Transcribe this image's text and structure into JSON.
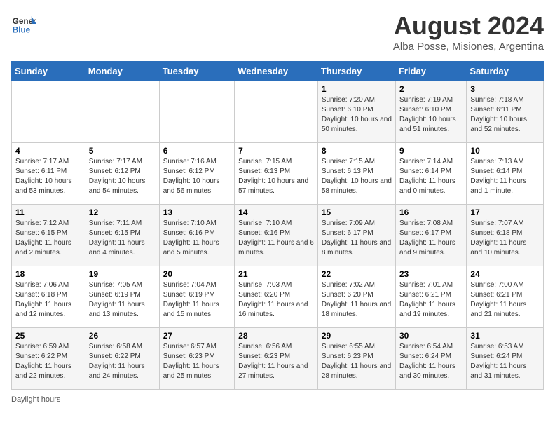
{
  "header": {
    "logo_general": "General",
    "logo_blue": "Blue",
    "month": "August 2024",
    "location": "Alba Posse, Misiones, Argentina"
  },
  "days_of_week": [
    "Sunday",
    "Monday",
    "Tuesday",
    "Wednesday",
    "Thursday",
    "Friday",
    "Saturday"
  ],
  "weeks": [
    [
      {
        "day": "",
        "info": ""
      },
      {
        "day": "",
        "info": ""
      },
      {
        "day": "",
        "info": ""
      },
      {
        "day": "",
        "info": ""
      },
      {
        "day": "1",
        "info": "Sunrise: 7:20 AM\nSunset: 6:10 PM\nDaylight: 10 hours and 50 minutes."
      },
      {
        "day": "2",
        "info": "Sunrise: 7:19 AM\nSunset: 6:10 PM\nDaylight: 10 hours and 51 minutes."
      },
      {
        "day": "3",
        "info": "Sunrise: 7:18 AM\nSunset: 6:11 PM\nDaylight: 10 hours and 52 minutes."
      }
    ],
    [
      {
        "day": "4",
        "info": "Sunrise: 7:17 AM\nSunset: 6:11 PM\nDaylight: 10 hours and 53 minutes."
      },
      {
        "day": "5",
        "info": "Sunrise: 7:17 AM\nSunset: 6:12 PM\nDaylight: 10 hours and 54 minutes."
      },
      {
        "day": "6",
        "info": "Sunrise: 7:16 AM\nSunset: 6:12 PM\nDaylight: 10 hours and 56 minutes."
      },
      {
        "day": "7",
        "info": "Sunrise: 7:15 AM\nSunset: 6:13 PM\nDaylight: 10 hours and 57 minutes."
      },
      {
        "day": "8",
        "info": "Sunrise: 7:15 AM\nSunset: 6:13 PM\nDaylight: 10 hours and 58 minutes."
      },
      {
        "day": "9",
        "info": "Sunrise: 7:14 AM\nSunset: 6:14 PM\nDaylight: 11 hours and 0 minutes."
      },
      {
        "day": "10",
        "info": "Sunrise: 7:13 AM\nSunset: 6:14 PM\nDaylight: 11 hours and 1 minute."
      }
    ],
    [
      {
        "day": "11",
        "info": "Sunrise: 7:12 AM\nSunset: 6:15 PM\nDaylight: 11 hours and 2 minutes."
      },
      {
        "day": "12",
        "info": "Sunrise: 7:11 AM\nSunset: 6:15 PM\nDaylight: 11 hours and 4 minutes."
      },
      {
        "day": "13",
        "info": "Sunrise: 7:10 AM\nSunset: 6:16 PM\nDaylight: 11 hours and 5 minutes."
      },
      {
        "day": "14",
        "info": "Sunrise: 7:10 AM\nSunset: 6:16 PM\nDaylight: 11 hours and 6 minutes."
      },
      {
        "day": "15",
        "info": "Sunrise: 7:09 AM\nSunset: 6:17 PM\nDaylight: 11 hours and 8 minutes."
      },
      {
        "day": "16",
        "info": "Sunrise: 7:08 AM\nSunset: 6:17 PM\nDaylight: 11 hours and 9 minutes."
      },
      {
        "day": "17",
        "info": "Sunrise: 7:07 AM\nSunset: 6:18 PM\nDaylight: 11 hours and 10 minutes."
      }
    ],
    [
      {
        "day": "18",
        "info": "Sunrise: 7:06 AM\nSunset: 6:18 PM\nDaylight: 11 hours and 12 minutes."
      },
      {
        "day": "19",
        "info": "Sunrise: 7:05 AM\nSunset: 6:19 PM\nDaylight: 11 hours and 13 minutes."
      },
      {
        "day": "20",
        "info": "Sunrise: 7:04 AM\nSunset: 6:19 PM\nDaylight: 11 hours and 15 minutes."
      },
      {
        "day": "21",
        "info": "Sunrise: 7:03 AM\nSunset: 6:20 PM\nDaylight: 11 hours and 16 minutes."
      },
      {
        "day": "22",
        "info": "Sunrise: 7:02 AM\nSunset: 6:20 PM\nDaylight: 11 hours and 18 minutes."
      },
      {
        "day": "23",
        "info": "Sunrise: 7:01 AM\nSunset: 6:21 PM\nDaylight: 11 hours and 19 minutes."
      },
      {
        "day": "24",
        "info": "Sunrise: 7:00 AM\nSunset: 6:21 PM\nDaylight: 11 hours and 21 minutes."
      }
    ],
    [
      {
        "day": "25",
        "info": "Sunrise: 6:59 AM\nSunset: 6:22 PM\nDaylight: 11 hours and 22 minutes."
      },
      {
        "day": "26",
        "info": "Sunrise: 6:58 AM\nSunset: 6:22 PM\nDaylight: 11 hours and 24 minutes."
      },
      {
        "day": "27",
        "info": "Sunrise: 6:57 AM\nSunset: 6:23 PM\nDaylight: 11 hours and 25 minutes."
      },
      {
        "day": "28",
        "info": "Sunrise: 6:56 AM\nSunset: 6:23 PM\nDaylight: 11 hours and 27 minutes."
      },
      {
        "day": "29",
        "info": "Sunrise: 6:55 AM\nSunset: 6:23 PM\nDaylight: 11 hours and 28 minutes."
      },
      {
        "day": "30",
        "info": "Sunrise: 6:54 AM\nSunset: 6:24 PM\nDaylight: 11 hours and 30 minutes."
      },
      {
        "day": "31",
        "info": "Sunrise: 6:53 AM\nSunset: 6:24 PM\nDaylight: 11 hours and 31 minutes."
      }
    ]
  ],
  "footer": {
    "daylight_label": "Daylight hours"
  }
}
